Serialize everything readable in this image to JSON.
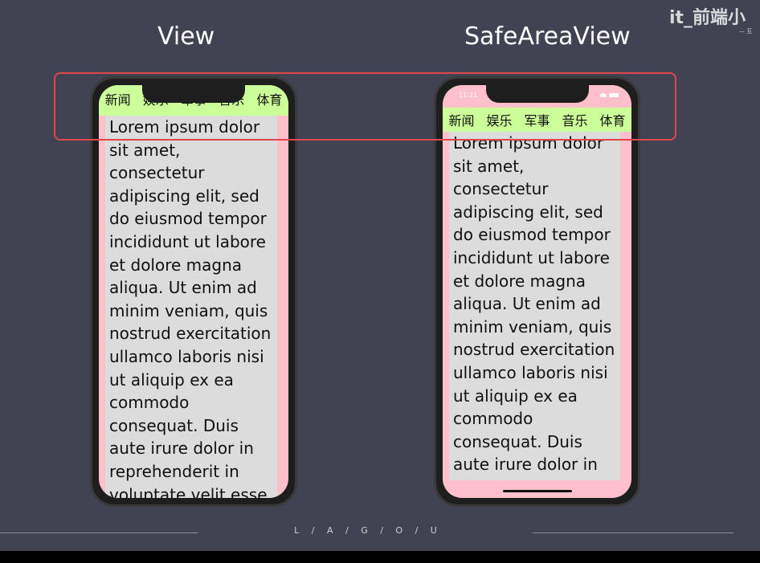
{
  "titles": {
    "left": "View",
    "right": "SafeAreaView"
  },
  "watermark": {
    "main": "it_前端小",
    "sub": "— 互"
  },
  "left_phone": {
    "tabs": [
      "新闻",
      "娱乐",
      "军事",
      "音乐",
      "体育"
    ],
    "content": "Lorem ipsum dolor sit amet, consectetur adipiscing elit, sed do eiusmod tempor incididunt ut labore et dolore magna aliqua. Ut enim ad minim veniam, quis nostrud exercitation ullamco laboris nisi ut aliquip ex ea commodo consequat. Duis aute irure dolor in reprehenderit in voluptate velit esse cillum dolore eu"
  },
  "right_phone": {
    "status_time": "11:21",
    "tabs": [
      "新闻",
      "娱乐",
      "军事",
      "音乐",
      "体育"
    ],
    "content": "Lorem ipsum dolor sit amet, consectetur adipiscing elit, sed do eiusmod tempor incididunt ut labore et dolore magna aliqua. Ut enim ad minim veniam, quis nostrud exercitation ullamco laboris nisi ut aliquip ex ea commodo consequat. Duis aute irure dolor in reprehenderit in"
  },
  "footer": {
    "text": "L / A / G / O / U"
  },
  "colors": {
    "background": "#414353",
    "tabbar": "#ccff99",
    "safe_area": "#ffc0cb",
    "content": "#dcdcdc",
    "highlight": "#e0474a"
  }
}
